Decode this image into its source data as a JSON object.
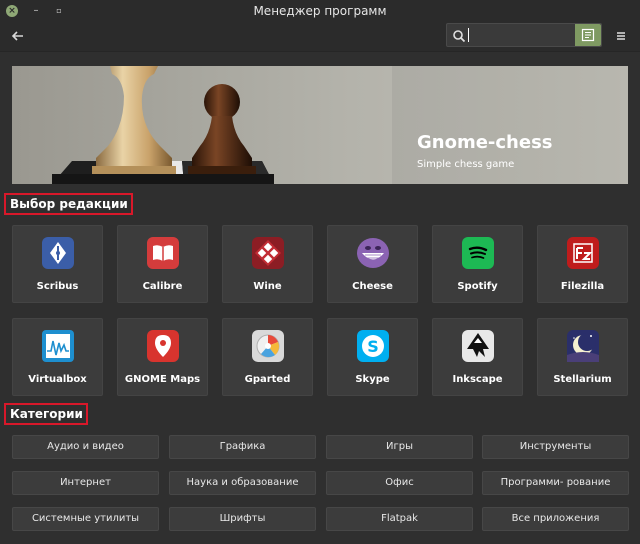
{
  "window": {
    "title": "Менеджер программ"
  },
  "search": {
    "placeholder": ""
  },
  "banner": {
    "title": "Gnome-chess",
    "subtitle": "Simple chess game"
  },
  "sections": {
    "editors_choice": "Выбор редакции",
    "categories": "Категории"
  },
  "apps_row1": [
    {
      "label": "Scribus",
      "icon": "scribus-icon"
    },
    {
      "label": "Calibre",
      "icon": "calibre-icon"
    },
    {
      "label": "Wine",
      "icon": "wine-icon"
    },
    {
      "label": "Cheese",
      "icon": "cheese-icon"
    },
    {
      "label": "Spotify",
      "icon": "spotify-icon"
    },
    {
      "label": "Filezilla",
      "icon": "filezilla-icon"
    }
  ],
  "apps_row2": [
    {
      "label": "Virtualbox",
      "icon": "virtualbox-icon"
    },
    {
      "label": "GNOME Maps",
      "icon": "gnome-maps-icon"
    },
    {
      "label": "Gparted",
      "icon": "gparted-icon"
    },
    {
      "label": "Skype",
      "icon": "skype-icon"
    },
    {
      "label": "Inkscape",
      "icon": "inkscape-icon"
    },
    {
      "label": "Stellarium",
      "icon": "stellarium-icon"
    }
  ],
  "categories": [
    "Аудио и видео",
    "Графика",
    "Игры",
    "Инструменты",
    "Интернет",
    "Наука и образование",
    "Офис",
    "Программи- рование",
    "Системные утилиты",
    "Шрифты",
    "Flatpak",
    "Все приложения"
  ],
  "colors": {
    "accent": "#7f9a62",
    "highlight": "#d9182a",
    "background": "#2f2f2f",
    "tile": "#3c3c3c"
  }
}
